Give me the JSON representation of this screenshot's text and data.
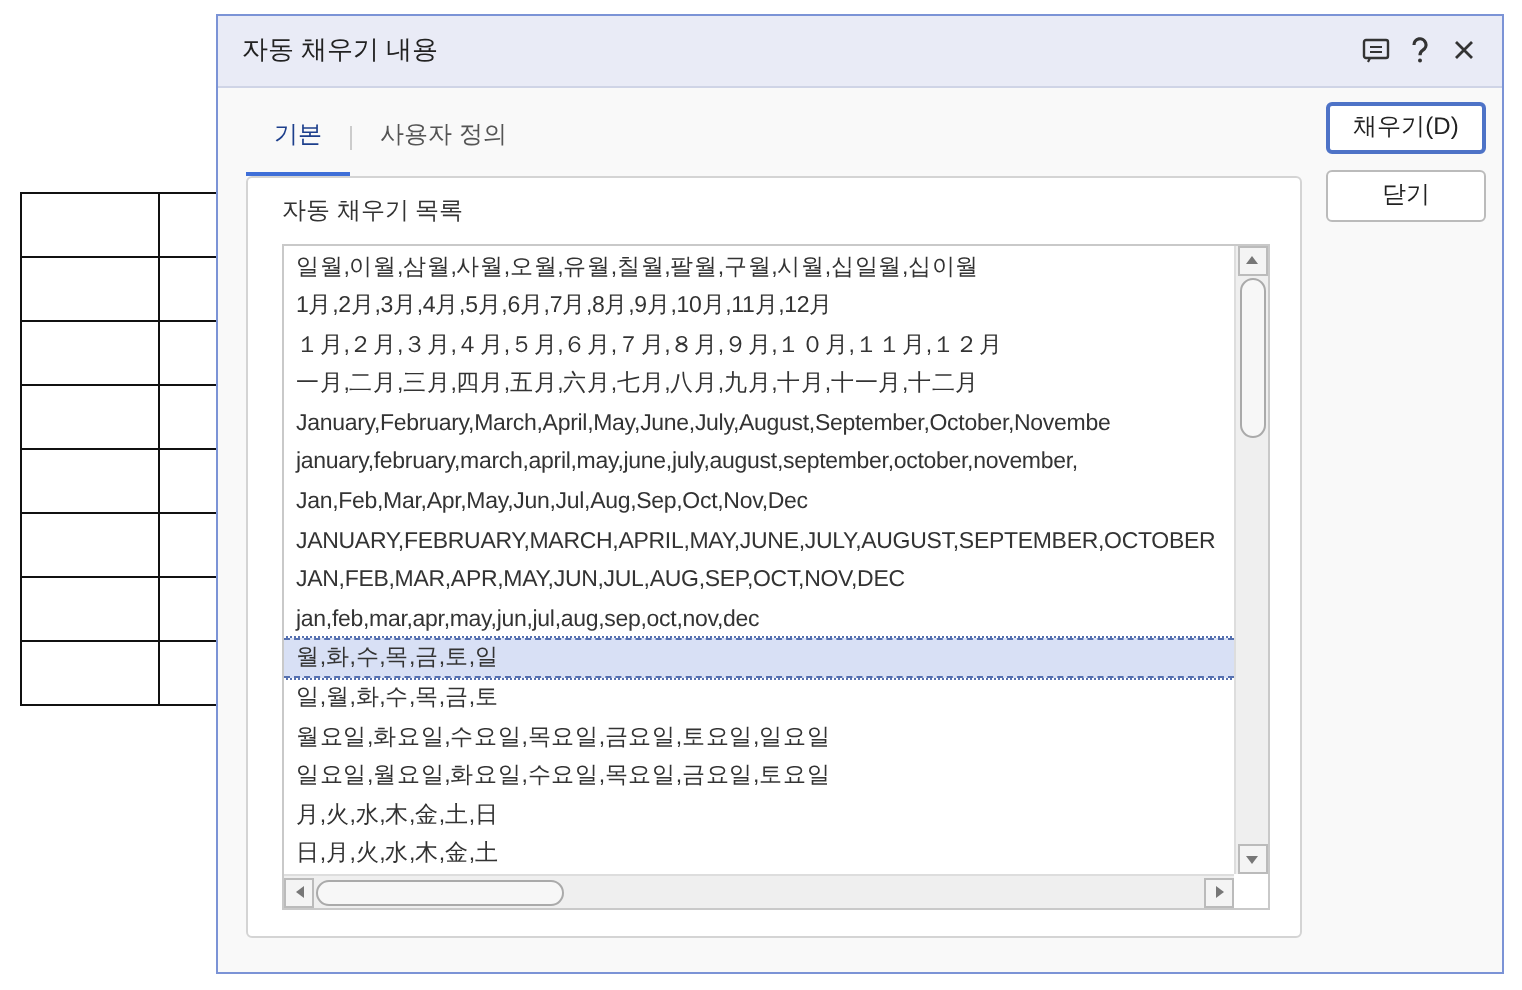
{
  "window": {
    "title": "자동 채우기 내용"
  },
  "tabs": [
    {
      "label": "기본",
      "selected": true
    },
    {
      "label": "사용자 정의",
      "selected": false
    }
  ],
  "list_group": {
    "label": "자동 채우기 목록",
    "items": [
      {
        "text": "일월,이월,삼월,사월,오월,유월,칠월,팔월,구월,시월,십일월,십이월",
        "selected": false
      },
      {
        "text": "1月,2月,3月,4月,5月,6月,7月,8月,9月,10月,11月,12月",
        "selected": false
      },
      {
        "text": "１月,２月,３月,４月,５月,６月,７月,８月,９月,１０月,１１月,１２月",
        "selected": false
      },
      {
        "text": "一月,二月,三月,四月,五月,六月,七月,八月,九月,十月,十一月,十二月",
        "selected": false
      },
      {
        "text": "January,February,March,April,May,June,July,August,September,October,Novembe",
        "selected": false
      },
      {
        "text": "january,february,march,april,may,june,july,august,september,october,november,",
        "selected": false
      },
      {
        "text": "Jan,Feb,Mar,Apr,May,Jun,Jul,Aug,Sep,Oct,Nov,Dec",
        "selected": false
      },
      {
        "text": "JANUARY,FEBRUARY,MARCH,APRIL,MAY,JUNE,JULY,AUGUST,SEPTEMBER,OCTOBER",
        "selected": false
      },
      {
        "text": "JAN,FEB,MAR,APR,MAY,JUN,JUL,AUG,SEP,OCT,NOV,DEC",
        "selected": false
      },
      {
        "text": "jan,feb,mar,apr,may,jun,jul,aug,sep,oct,nov,dec",
        "selected": false
      },
      {
        "text": "월,화,수,목,금,토,일",
        "selected": true
      },
      {
        "text": "일,월,화,수,목,금,토",
        "selected": false
      },
      {
        "text": "월요일,화요일,수요일,목요일,금요일,토요일,일요일",
        "selected": false
      },
      {
        "text": "일요일,월요일,화요일,수요일,목요일,금요일,토요일",
        "selected": false
      },
      {
        "text": "月,火,水,木,金,土,日",
        "selected": false
      },
      {
        "text": "日,月,火,水,木,金,土",
        "selected": false
      }
    ]
  },
  "buttons": [
    {
      "label": "채우기(D)",
      "default": true
    },
    {
      "label": "닫기",
      "default": false
    }
  ]
}
